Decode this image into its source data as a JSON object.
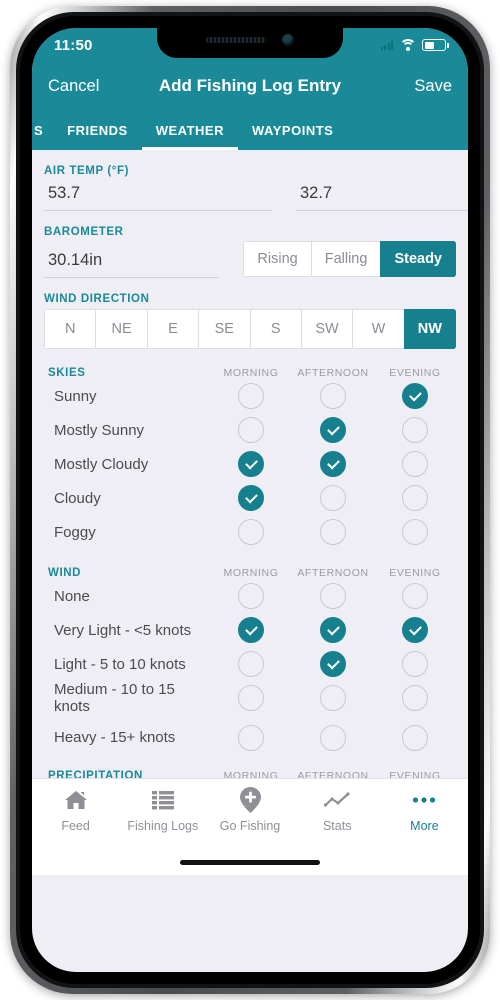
{
  "status_bar": {
    "time": "11:50",
    "signal_icon": "signal-bars-icon",
    "wifi_icon": "wifi-icon",
    "battery_icon": "battery-icon"
  },
  "nav": {
    "cancel_label": "Cancel",
    "title": "Add Fishing Log Entry",
    "save_label": "Save"
  },
  "top_tabs": [
    {
      "label": "S",
      "active": false,
      "cut_off": true
    },
    {
      "label": "FRIENDS",
      "active": false
    },
    {
      "label": "WEATHER",
      "active": true
    },
    {
      "label": "WAYPOINTS",
      "active": false
    }
  ],
  "form": {
    "air_temp": {
      "label": "AIR TEMP (°F)",
      "value_high": "53.7",
      "value_low": "32.7"
    },
    "barometer": {
      "label": "BAROMETER",
      "value": "30.14in",
      "trend_options": [
        "Rising",
        "Falling",
        "Steady"
      ],
      "trend_selected": "Steady"
    },
    "wind_direction": {
      "label": "WIND DIRECTION",
      "options": [
        "N",
        "NE",
        "E",
        "SE",
        "S",
        "SW",
        "W",
        "NW"
      ],
      "selected": "NW"
    }
  },
  "time_columns": [
    "MORNING",
    "AFTERNOON",
    "EVENING"
  ],
  "matrices": [
    {
      "title": "SKIES",
      "rows": [
        {
          "label": "Sunny",
          "checks": [
            false,
            false,
            true
          ]
        },
        {
          "label": "Mostly Sunny",
          "checks": [
            false,
            true,
            false
          ]
        },
        {
          "label": "Mostly Cloudy",
          "checks": [
            true,
            true,
            false
          ]
        },
        {
          "label": "Cloudy",
          "checks": [
            true,
            false,
            false
          ]
        },
        {
          "label": "Foggy",
          "checks": [
            false,
            false,
            false
          ]
        }
      ]
    },
    {
      "title": "WIND",
      "rows": [
        {
          "label": "None",
          "checks": [
            false,
            false,
            false
          ]
        },
        {
          "label": "Very Light - <5 knots",
          "checks": [
            true,
            true,
            true
          ]
        },
        {
          "label": "Light - 5 to 10 knots",
          "checks": [
            false,
            true,
            false
          ]
        },
        {
          "label": "Medium - 10 to 15 knots",
          "checks": [
            false,
            false,
            false
          ]
        },
        {
          "label": "Heavy - 15+ knots",
          "checks": [
            false,
            false,
            false
          ],
          "tall": true
        }
      ]
    },
    {
      "title": "PRECIPITATION",
      "rows": []
    }
  ],
  "bottom_tabs": [
    {
      "label": "Feed",
      "icon": "home-icon",
      "active": false
    },
    {
      "label": "Fishing Logs",
      "icon": "list-icon",
      "active": false
    },
    {
      "label": "Go Fishing",
      "icon": "map-pin-plus-icon",
      "active": false
    },
    {
      "label": "Stats",
      "icon": "line-chart-icon",
      "active": false
    },
    {
      "label": "More",
      "icon": "ellipsis-icon",
      "active": true
    }
  ],
  "colors": {
    "accent_teal": "#16808f",
    "header_teal": "#1a8a99",
    "screen_bg": "#eeeef4",
    "muted_text": "#8e9096"
  }
}
